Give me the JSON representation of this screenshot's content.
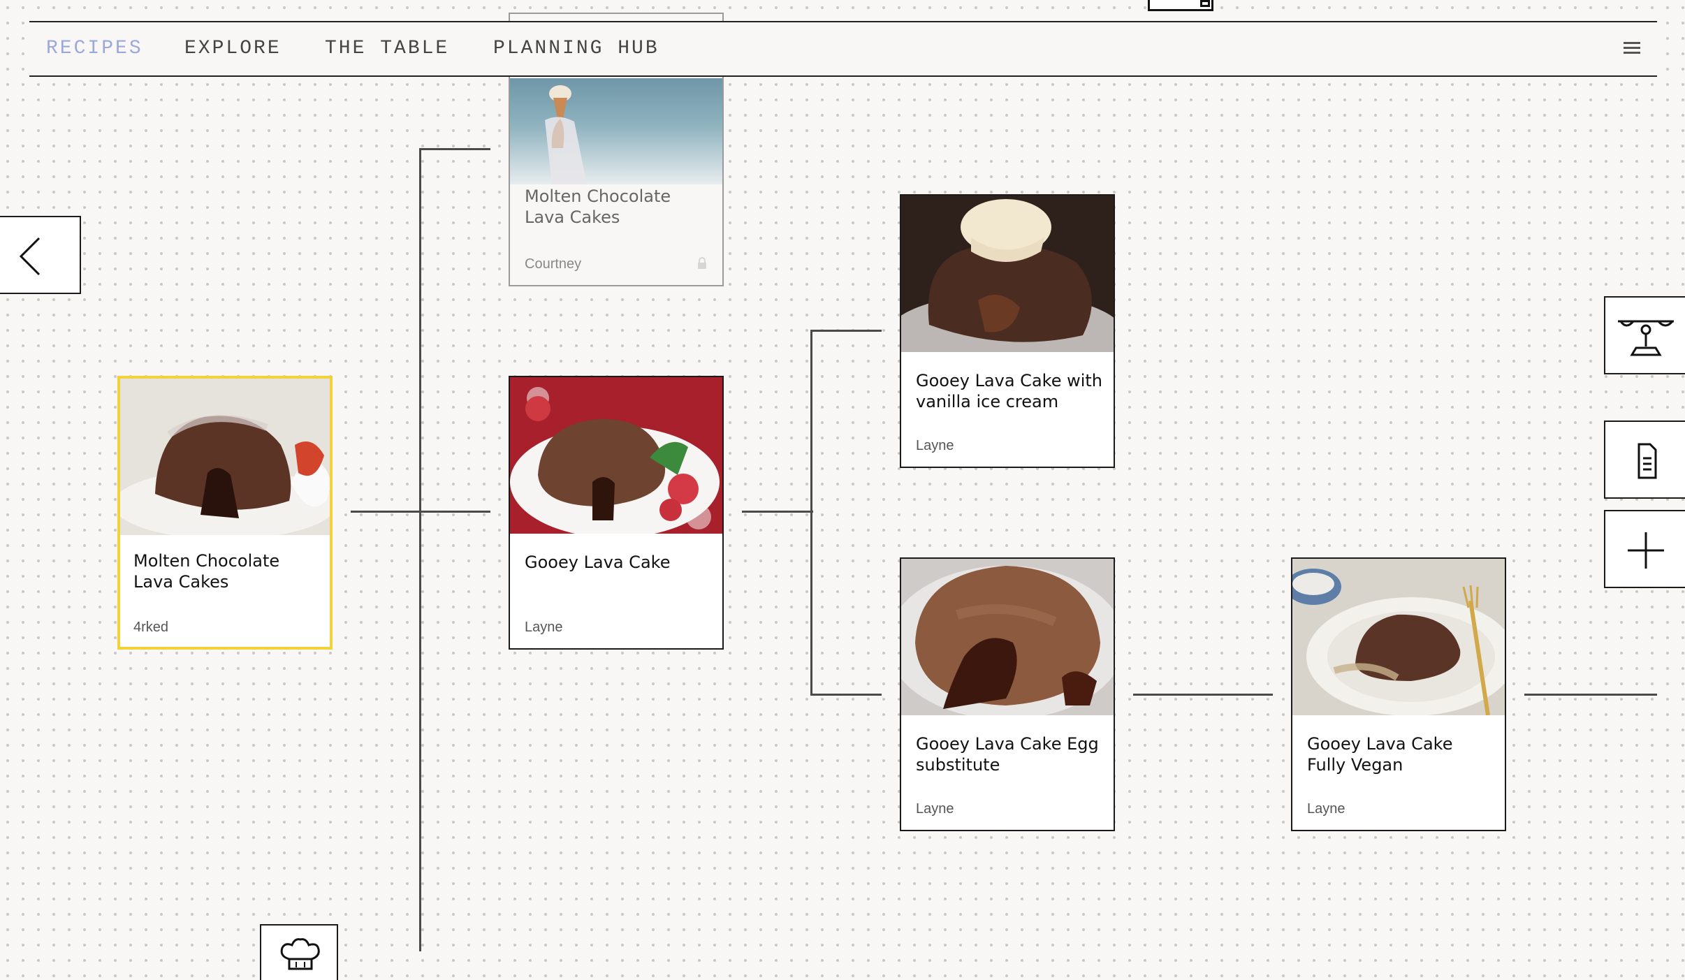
{
  "nav": {
    "items": [
      {
        "label": "RECIPES",
        "active": true
      },
      {
        "label": "EXPLORE",
        "active": false
      },
      {
        "label": "THE TABLE",
        "active": false
      },
      {
        "label": "PLANNING HUB",
        "active": false
      }
    ],
    "menu_icon": "hamburger-menu-icon",
    "active_color": "#9aa8dc"
  },
  "tree": {
    "root": {
      "title": "Molten Chocolate Lava Cakes",
      "author": "4rked",
      "selected": true,
      "highlight_color": "#f1d23a"
    },
    "parent_variant": {
      "title": "Molten Chocolate Lava Cakes",
      "author": "Courtney",
      "locked": true
    },
    "child": {
      "title": "Gooey Lava Cake",
      "author": "Layne"
    },
    "grandchildren": [
      {
        "title": "Gooey Lava Cake with vanilla ice cream",
        "author": "Layne"
      },
      {
        "title": "Gooey Lava Cake Egg substitute",
        "author": "Layne"
      }
    ],
    "great_grandchild": {
      "title": "Gooey Lava Cake Fully Vegan",
      "author": "Layne"
    }
  },
  "controls": {
    "back": "chevron-left-icon",
    "scale": "balance-scale-icon",
    "notes": "document-icon",
    "add": "plus-icon",
    "chef": "chef-hat-icon"
  }
}
